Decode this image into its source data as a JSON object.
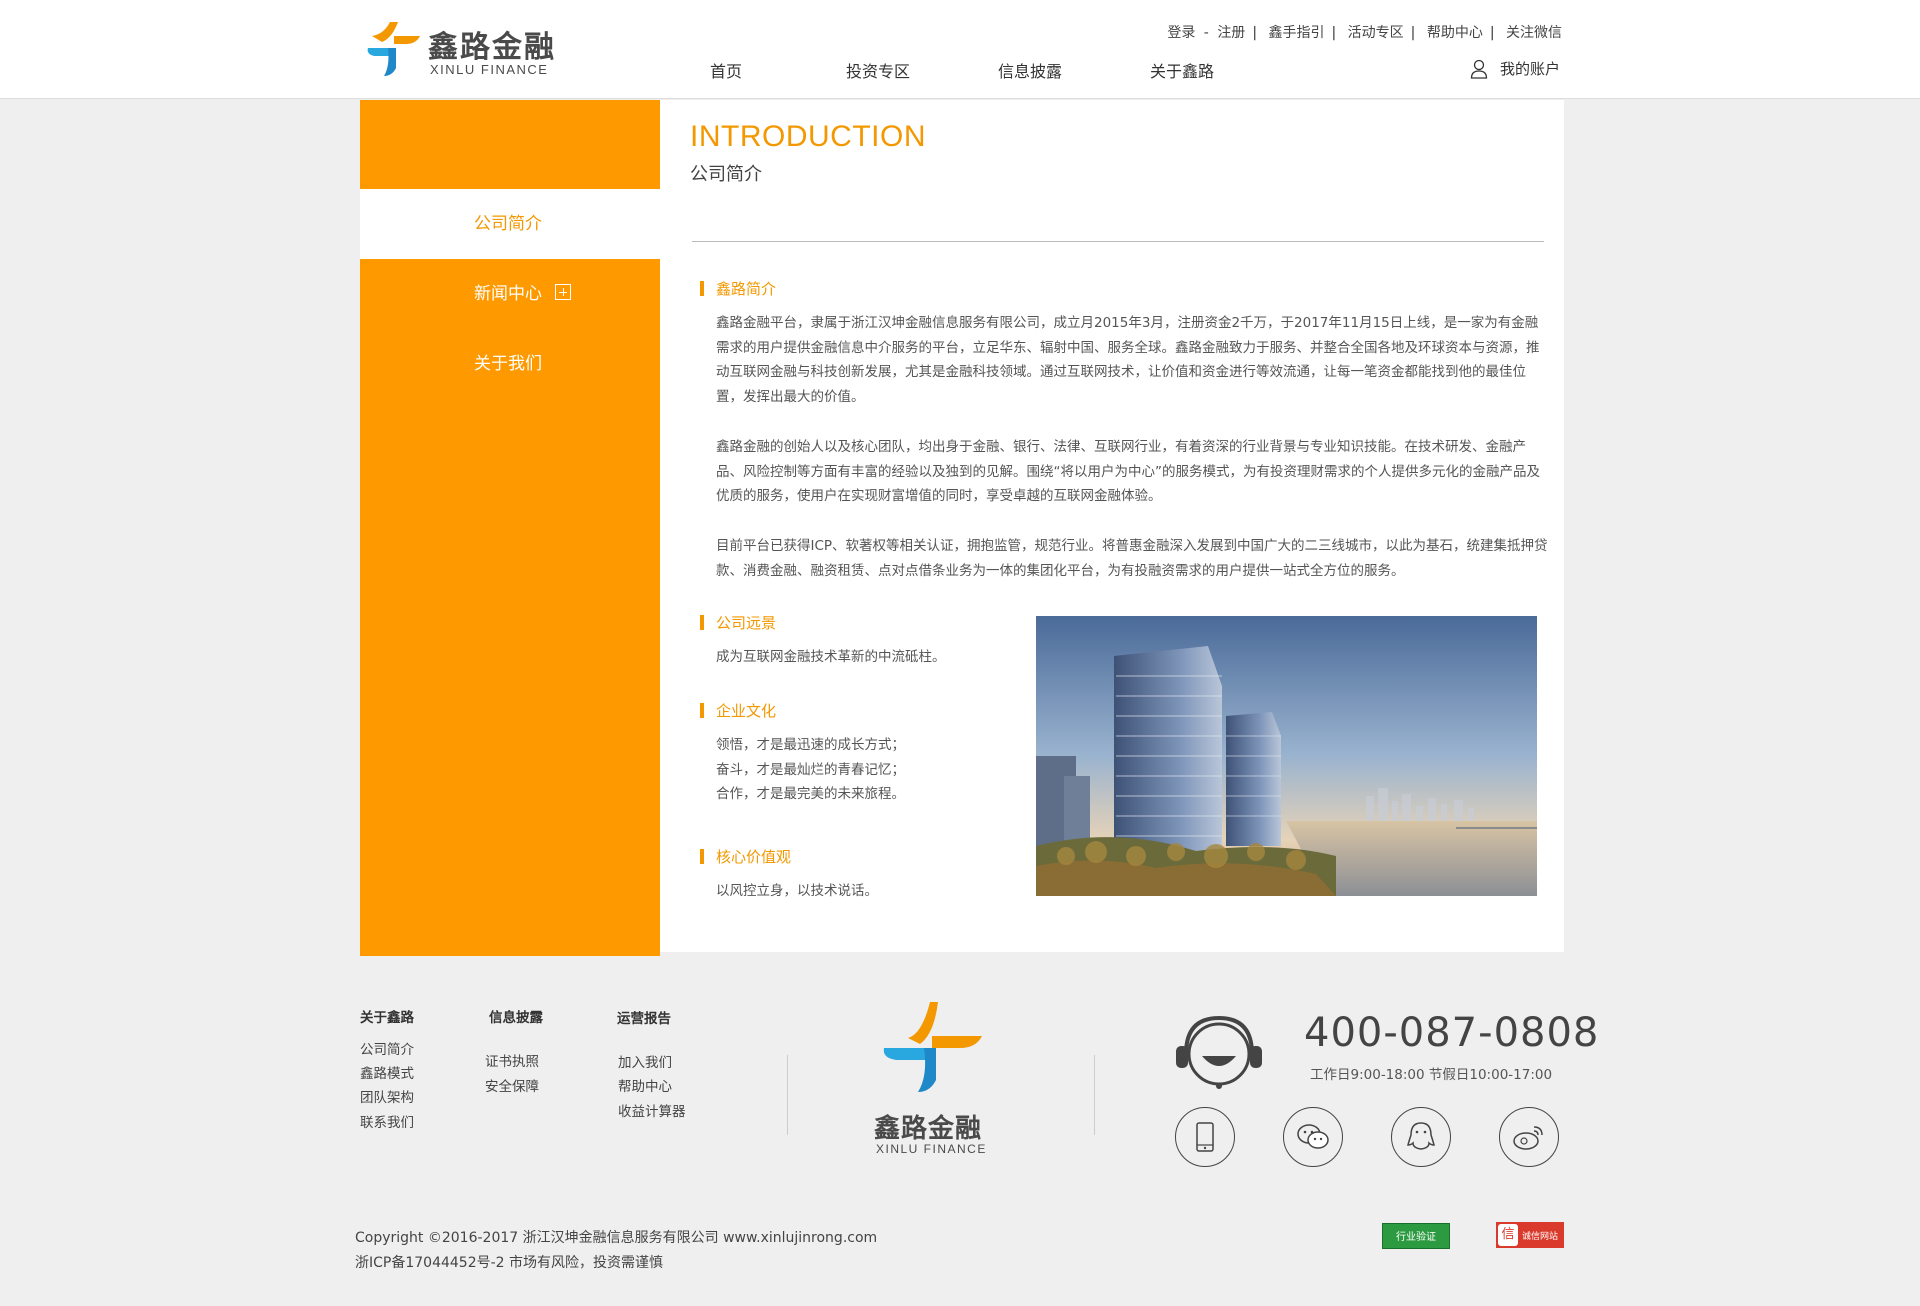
{
  "header": {
    "logo_cn": "鑫路金融",
    "logo_en": "XINLU FINANCE",
    "top_links": [
      "登录",
      "注册",
      "鑫手指引",
      "活动专区",
      "帮助中心",
      "关注微信"
    ],
    "login_sep": "-",
    "nav": [
      "首页",
      "投资专区",
      "信息披露",
      "关于鑫路"
    ],
    "account": "我的账户"
  },
  "sidebar": {
    "items": [
      {
        "label": "公司简介",
        "active": true
      },
      {
        "label": "新闻中心",
        "expandable": true
      },
      {
        "label": "关于我们"
      }
    ]
  },
  "content": {
    "title_en": "INTRODUCTION",
    "title_cn": "公司简介",
    "sections": {
      "intro": {
        "title": "鑫路简介",
        "paragraphs": [
          "鑫路金融平台，隶属于浙江汉坤金融信息服务有限公司，成立月2015年3月，注册资金2千万，于2017年11月15日上线，是一家为有金融需求的用户提供金融信息中介服务的平台，立足华东、辐射中国、服务全球。鑫路金融致力于服务、并整合全国各地及环球资本与资源，推动互联网金融与科技创新发展，尤其是金融科技领域。通过互联网技术，让价值和资金进行等效流通，让每一笔资金都能找到他的最佳位置，发挥出最大的价值。",
          "鑫路金融的创始人以及核心团队，均出身于金融、银行、法律、互联网行业，有着资深的行业背景与专业知识技能。在技术研发、金融产品、风险控制等方面有丰富的经验以及独到的见解。围绕“将以用户为中心”的服务模式，为有投资理财需求的个人提供多元化的金融产品及优质的服务，使用户在实现财富增值的同时，享受卓越的互联网金融体验。",
          "目前平台已获得ICP、软著权等相关认证，拥抱监管，规范行业。将普惠金融深入发展到中国广大的二三线城市，以此为基石，统建集抵押贷款、消费金融、融资租赁、点对点借条业务为一体的集团化平台，为有投融资需求的用户提供一站式全方位的服务。"
        ]
      },
      "vision": {
        "title": "公司远景",
        "text": "成为互联网金融技术革新的中流砥柱。"
      },
      "culture": {
        "title": "企业文化",
        "lines": [
          "领悟，才是最迅速的成长方式；",
          "奋斗，才是最灿烂的青春记忆；",
          "合作，才是最完美的未来旅程。"
        ]
      },
      "values": {
        "title": "核心价值观",
        "text": "以风控立身，以技术说话。"
      }
    },
    "image_name": "office-building-photo"
  },
  "footer": {
    "columns": [
      {
        "title": "关于鑫路",
        "links": [
          "公司简介",
          "鑫路模式",
          "团队架构",
          "联系我们"
        ]
      },
      {
        "title": "信息披露",
        "links": [
          "证书执照",
          "安全保障"
        ]
      },
      {
        "title": "运营报告",
        "links": [
          "加入我们",
          "帮助中心",
          "收益计算器"
        ]
      }
    ],
    "logo_cn": "鑫路金融",
    "logo_en": "XINLU FINANCE",
    "phone": "400-087-0808",
    "hours": "工作日9:00-18:00  节假日10:00-17:00",
    "social_icons": [
      "mobile-icon",
      "wechat-icon",
      "qq-icon",
      "weibo-icon"
    ],
    "copyright_line1": "Copyright ©2016-2017 浙江汉坤金融信息服务有限公司 www.xinlujinrong.com",
    "copyright_line2": "浙ICP备17044452号-2 市场有风险，投资需谨慎",
    "badge_green": "行业验证",
    "badge_red_char": "信",
    "badge_red_text": "诚信网站"
  },
  "colors": {
    "accent": "#f39800",
    "sidebar_bg": "#fe9a00",
    "page_bg": "#efefef"
  }
}
